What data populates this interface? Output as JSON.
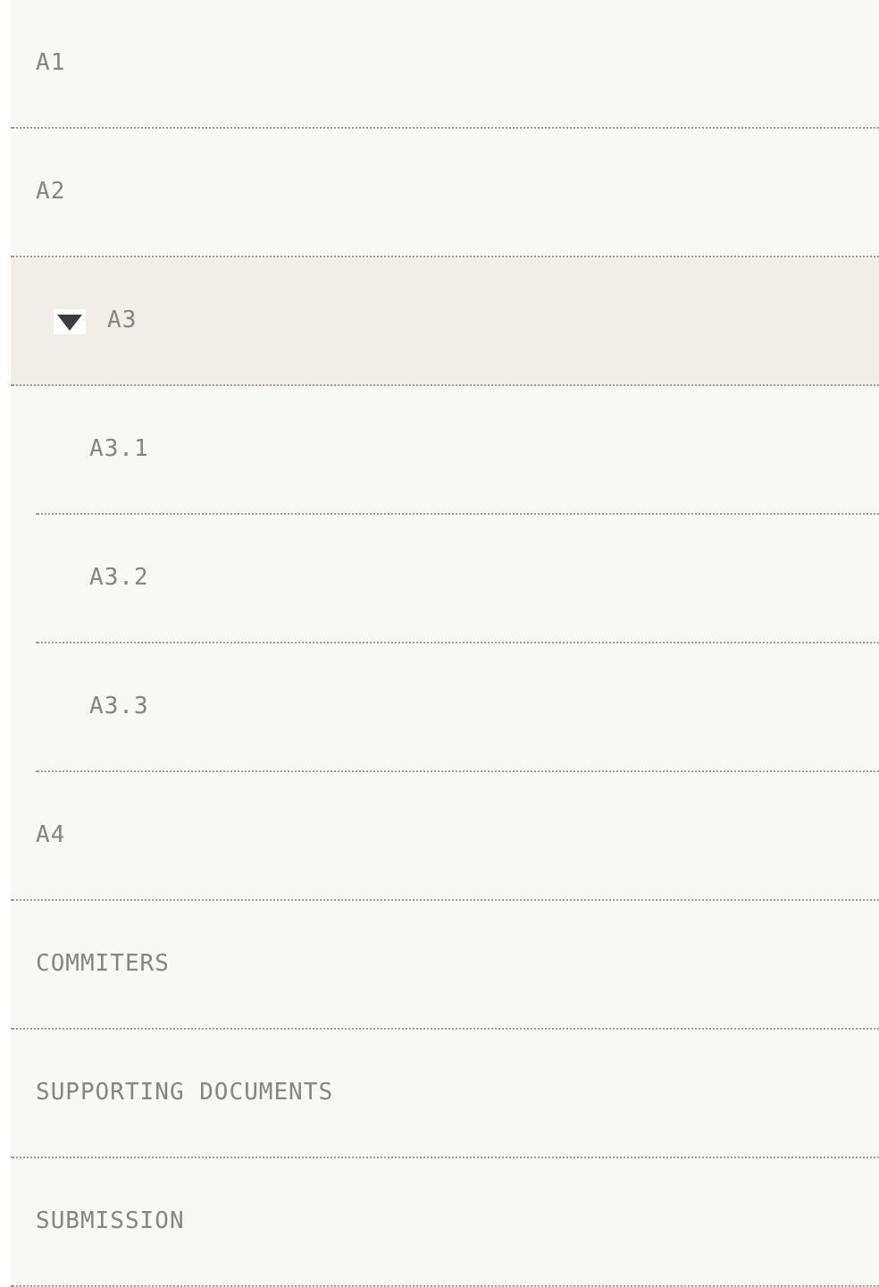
{
  "nav": {
    "items": [
      {
        "label": "A1",
        "selected": false
      },
      {
        "label": "A2",
        "selected": false
      },
      {
        "label": "A3",
        "selected": true,
        "expanded": true,
        "children": [
          {
            "label": "A3.1",
            "selected": false
          },
          {
            "label": "A3.2",
            "selected": false
          },
          {
            "label": "A3.3",
            "selected": false
          }
        ]
      },
      {
        "label": "A4",
        "selected": false
      },
      {
        "label": "COMMITERS",
        "selected": false
      },
      {
        "label": "SUPPORTING DOCUMENTS",
        "selected": false
      },
      {
        "label": "SUBMISSION",
        "selected": false
      }
    ]
  }
}
